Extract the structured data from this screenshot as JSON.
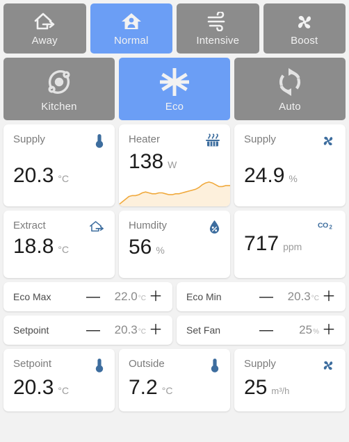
{
  "modes_row1": [
    {
      "label": "Away",
      "icon": "house-exit-icon",
      "active": false
    },
    {
      "label": "Normal",
      "icon": "house-person-icon",
      "active": true
    },
    {
      "label": "Intensive",
      "icon": "wind-icon",
      "active": false
    },
    {
      "label": "Boost",
      "icon": "fan-icon",
      "active": false
    }
  ],
  "modes_row2": [
    {
      "label": "Kitchen",
      "icon": "orbit-icon",
      "active": false
    },
    {
      "label": "Eco",
      "icon": "snowflake-icon",
      "active": true
    },
    {
      "label": "Auto",
      "icon": "refresh-icon",
      "active": false
    }
  ],
  "cards_row1": [
    {
      "title": "Supply",
      "value": "20.3",
      "unit": "°C",
      "icon": "thermometer-icon"
    },
    {
      "title": "Heater",
      "value": "138",
      "unit": "W",
      "icon": "radiator-icon"
    },
    {
      "title": "Supply",
      "value": "24.9",
      "unit": "%",
      "icon": "fan-icon"
    }
  ],
  "cards_row2": [
    {
      "title": "Extract",
      "value": "18.8",
      "unit": "°C",
      "icon": "house-exit-icon"
    },
    {
      "title": "Humdity",
      "value": "56",
      "unit": "%",
      "icon": "humidity-icon"
    },
    {
      "title": "",
      "value": "717",
      "unit": "ppm",
      "icon": "co2-icon"
    }
  ],
  "cards_row3": [
    {
      "title": "Setpoint",
      "value": "20.3",
      "unit": "°C",
      "icon": "thermometer-icon"
    },
    {
      "title": "Outside",
      "value": "7.2",
      "unit": "°C",
      "icon": "thermometer-icon"
    },
    {
      "title": "Supply",
      "value": "25",
      "unit": "m³/h",
      "icon": "fan-icon"
    }
  ],
  "steppers_row1": [
    {
      "label": "Eco Max",
      "value": "22.0",
      "unit": "°C",
      "minus": "—",
      "plus": "＋"
    },
    {
      "label": "Eco Min",
      "value": "20.3",
      "unit": "°C",
      "minus": "—",
      "plus": "＋"
    }
  ],
  "steppers_row2": [
    {
      "label": "Setpoint",
      "value": "20.3",
      "unit": "°C",
      "minus": "—",
      "plus": "＋"
    },
    {
      "label": "Set Fan",
      "value": "25",
      "unit": "%",
      "minus": "—",
      "plus": "＋"
    }
  ],
  "colors": {
    "background": "#f2f2f2",
    "button_inactive": "#8c8c8c",
    "button_active": "#6b9ef5",
    "card": "#ffffff",
    "icon_accent": "#3d6d9e",
    "spark_line": "#f0a93c",
    "spark_fill": "#fdf0dc"
  },
  "chart_data": {
    "type": "area",
    "title": "Heater",
    "ylabel": "W",
    "values": [
      3,
      6,
      9,
      12,
      13,
      13,
      14,
      16,
      17,
      16,
      15,
      15,
      16,
      16,
      15,
      14,
      14,
      15,
      15,
      16,
      17,
      18,
      19,
      20,
      22,
      25,
      27,
      28,
      27,
      25,
      23,
      23,
      24,
      24
    ],
    "grid": false,
    "legend": "none"
  }
}
